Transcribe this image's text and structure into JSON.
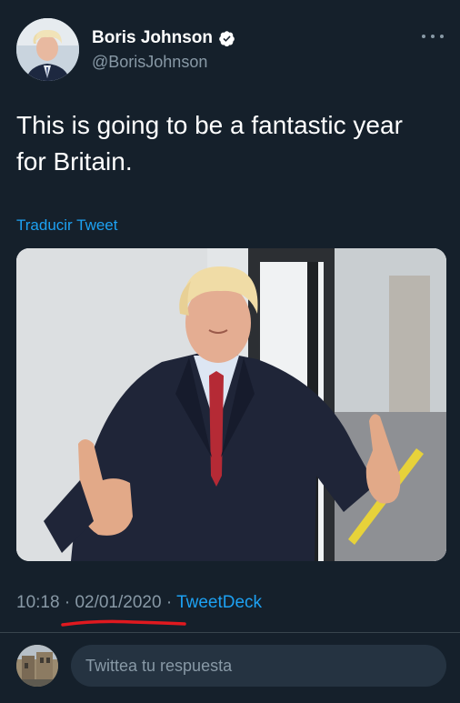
{
  "tweet": {
    "author_name": "Boris Johnson",
    "handle": "@BorisJohnson",
    "text": "This is going to be a fantastic year for Britain.",
    "translate_link": "Traducir Tweet",
    "time": "10:18",
    "separator": "·",
    "date": "02/01/2020",
    "source": "TweetDeck",
    "verified_icon": "verified-badge-icon",
    "more_icon": "more-options-icon",
    "media_description_icon": "photo-thumbs-up"
  },
  "reply": {
    "placeholder": "Twittea tu respuesta"
  },
  "colors": {
    "background": "#15202b",
    "accent": "#1da1f2",
    "secondary_text": "#8899a6",
    "divider": "#38444d",
    "reply_box": "#253341",
    "annotation_red": "#e0191f"
  }
}
